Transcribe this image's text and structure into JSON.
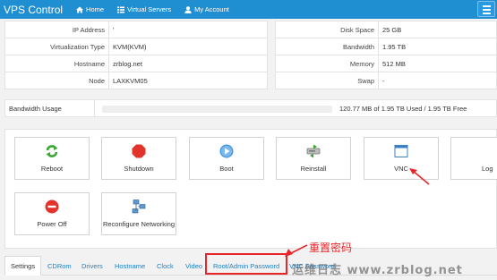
{
  "nav": {
    "brand": "VPS Control",
    "home": "Home",
    "servers": "Virtual Servers",
    "account": "My Account"
  },
  "left_info": [
    {
      "key": "IP Address",
      "value": "'"
    },
    {
      "key": "Virtualization Type",
      "value": "KVM(KVM)"
    },
    {
      "key": "Hostname",
      "value": "zrblog.net"
    },
    {
      "key": "Node",
      "value": "LAXKVM05"
    }
  ],
  "right_info": [
    {
      "key": "Disk Space",
      "value": "25 GB"
    },
    {
      "key": "Bandwidth",
      "value": "1.95 TB"
    },
    {
      "key": "Memory",
      "value": "512 MB"
    },
    {
      "key": "Swap",
      "value": "-"
    }
  ],
  "bandwidth": {
    "label": "Bandwidth Usage",
    "text": "120.77 MB of 1.95 TB Used / 1.95 TB Free",
    "fraction": 0.0001
  },
  "actions": [
    {
      "label": "Reboot",
      "icon": "reboot-icon"
    },
    {
      "label": "Shutdown",
      "icon": "shutdown-icon"
    },
    {
      "label": "Boot",
      "icon": "boot-icon"
    },
    {
      "label": "Reinstall",
      "icon": "reinstall-icon"
    },
    {
      "label": "VNC",
      "icon": "vnc-icon"
    },
    {
      "label": "Log",
      "icon": "log-icon"
    },
    {
      "label": "Power Off",
      "icon": "power-off-icon"
    },
    {
      "label": "Reconfigure Networking",
      "icon": "network-icon"
    }
  ],
  "tabs": [
    "Settings",
    "CDRom",
    "Drivers",
    "Hostname",
    "Clock",
    "Video",
    "Root/Admin Password",
    "VNC Password"
  ],
  "annotation": "重置密码",
  "watermark": "运维日志 www.zrblog.net",
  "colors": {
    "nav": "#1f8fd1",
    "highlight": "#e8262a",
    "link": "#1f7fc2"
  }
}
